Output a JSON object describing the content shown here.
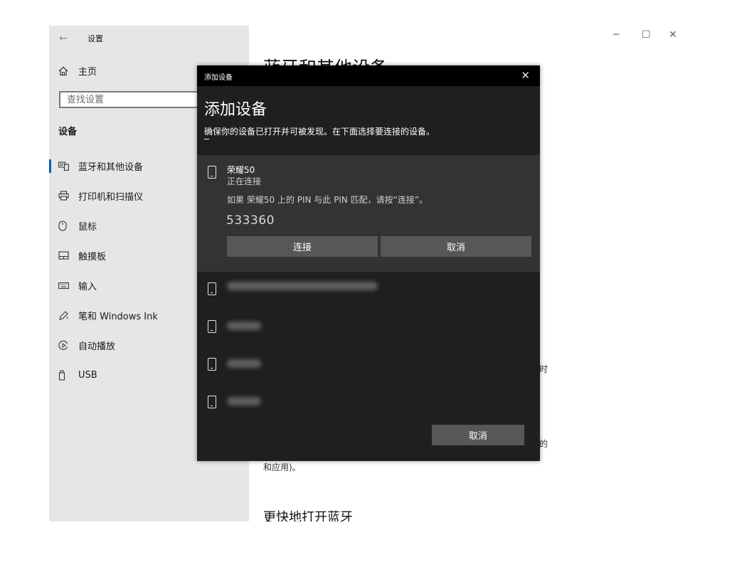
{
  "window": {
    "app_title": "设置",
    "back_icon": "back-arrow-icon",
    "controls": {
      "minimize_icon": "minimize-icon",
      "maximize_icon": "maximize-icon",
      "close_icon": "close-icon"
    }
  },
  "sidebar": {
    "home_label": "主页",
    "search_placeholder": "查找设置",
    "section_title": "设备",
    "items": [
      {
        "label": "蓝牙和其他设备",
        "icon": "devices-icon",
        "active": true
      },
      {
        "label": "打印机和扫描仪",
        "icon": "printer-icon",
        "active": false
      },
      {
        "label": "鼠标",
        "icon": "mouse-icon",
        "active": false
      },
      {
        "label": "触摸板",
        "icon": "touchpad-icon",
        "active": false
      },
      {
        "label": "输入",
        "icon": "keyboard-icon",
        "active": false
      },
      {
        "label": "笔和 Windows Ink",
        "icon": "pen-icon",
        "active": false
      },
      {
        "label": "自动播放",
        "icon": "autoplay-icon",
        "active": false
      },
      {
        "label": "USB",
        "icon": "usb-icon",
        "active": false
      }
    ]
  },
  "main": {
    "title_partial": "蓝牙和其他设备",
    "fragment_1": "时",
    "fragment_2": "的",
    "fragment_3": "和应用)。",
    "subtitle_partial": "更快地打开蓝牙"
  },
  "dialog": {
    "titlebar_label": "添加设备",
    "heading": "添加设备",
    "instruction": "确保你的设备已打开并可被发现。在下面选择要连接的设备。",
    "active_device": {
      "name": "荣耀50",
      "status": "正在连接",
      "pin_message": "如果 荣耀50 上的 PIN 与此 PIN 匹配，请按“连接”。",
      "pin": "533360",
      "connect_label": "连接",
      "cancel_label": "取消"
    },
    "other_devices_count": 4,
    "cancel_label": "取消"
  }
}
